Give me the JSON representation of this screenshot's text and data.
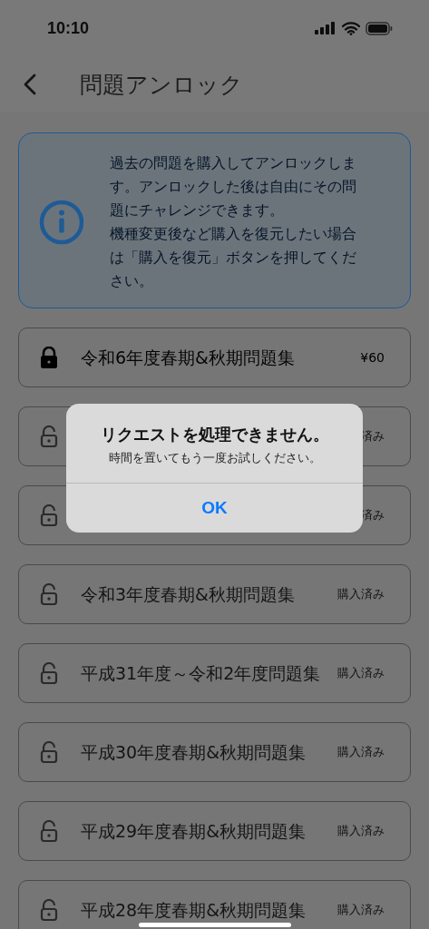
{
  "status_bar": {
    "time": "10:10"
  },
  "header": {
    "title": "問題アンロック"
  },
  "info": {
    "paragraphs": [
      "過去の問題を購入してアンロックします。アンロックした後は自由にその問題にチャレンジできます。",
      "機種変更後など購入を復元したい場合は「購入を復元」ボタンを押してください。"
    ]
  },
  "items": [
    {
      "title": "令和6年度春期&秋期問題集",
      "status": "¥60",
      "locked": true
    },
    {
      "status": "済み",
      "locked": false
    },
    {
      "status": "済み",
      "locked": false
    },
    {
      "title": "令和3年度春期&秋期問題集",
      "status": "購入済み",
      "locked": false
    },
    {
      "title": "平成31年度～令和2年度問題集",
      "status": "購入済み",
      "locked": false
    },
    {
      "title": "平成30年度春期&秋期問題集",
      "status": "購入済み",
      "locked": false
    },
    {
      "title": "平成29年度春期&秋期問題集",
      "status": "購入済み",
      "locked": false
    },
    {
      "title": "平成28年度春期&秋期問題集",
      "status": "購入済み",
      "locked": false
    }
  ],
  "alert": {
    "title": "リクエストを処理できません。",
    "message": "時間を置いてもう一度お試しください。",
    "button": "OK"
  }
}
